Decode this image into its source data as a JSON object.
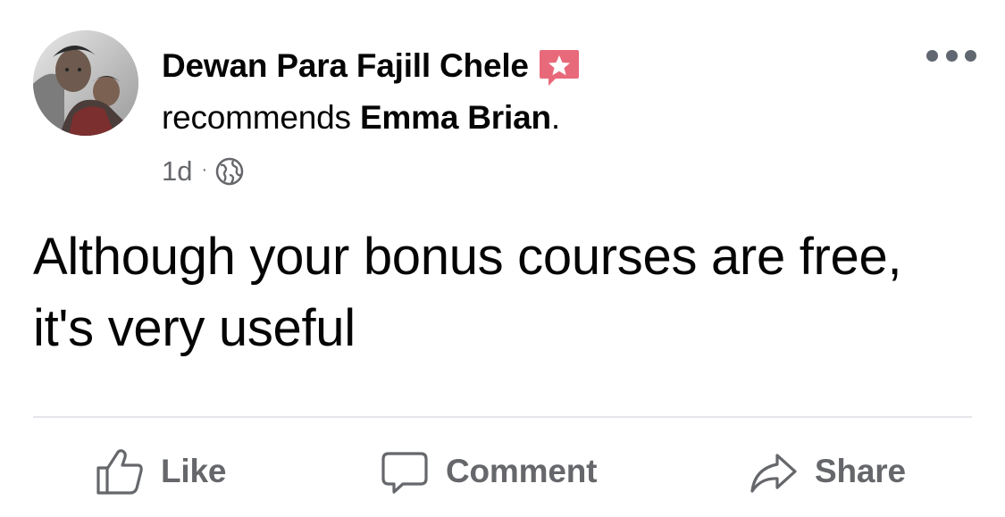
{
  "post": {
    "author": "Dewan Para Fajill Chele",
    "badge_icon": "recommendation-star-icon",
    "badge_color": "#e86a7a",
    "recommend_verb": "recommends",
    "page_name": "Emma Brian",
    "page_name_suffix": ".",
    "time": "1d",
    "separator": "·",
    "privacy_icon": "globe-icon",
    "body": "Although your bonus courses are free, it's very useful"
  },
  "actions": {
    "like": {
      "label": "Like",
      "icon": "thumbs-up-icon"
    },
    "comment": {
      "label": "Comment",
      "icon": "speech-bubble-icon"
    },
    "share": {
      "label": "Share",
      "icon": "share-arrow-icon"
    }
  },
  "menu": {
    "icon": "more-options-icon"
  },
  "colors": {
    "text_primary": "#050505",
    "text_secondary": "#65676b",
    "divider": "#e4e6eb"
  }
}
